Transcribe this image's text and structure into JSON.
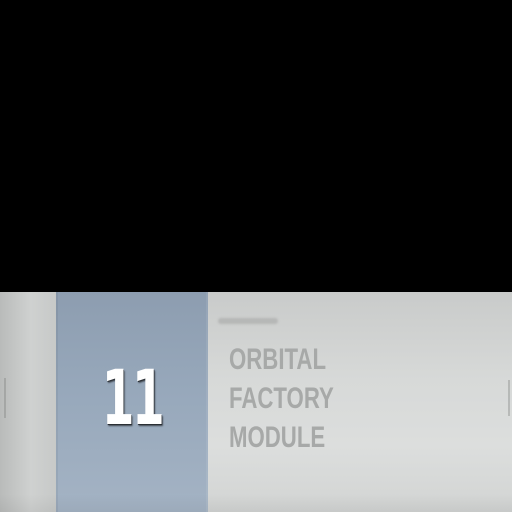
{
  "module": {
    "number": "11",
    "name_lines": [
      "ORBITAL",
      "FACTORY",
      "MODULE"
    ]
  },
  "colors": {
    "background": "#000000",
    "panel": "#d7d9d8",
    "number_block": "#97a8bb",
    "number_text": "#ffffff",
    "name_text": "#a7a9a8"
  }
}
